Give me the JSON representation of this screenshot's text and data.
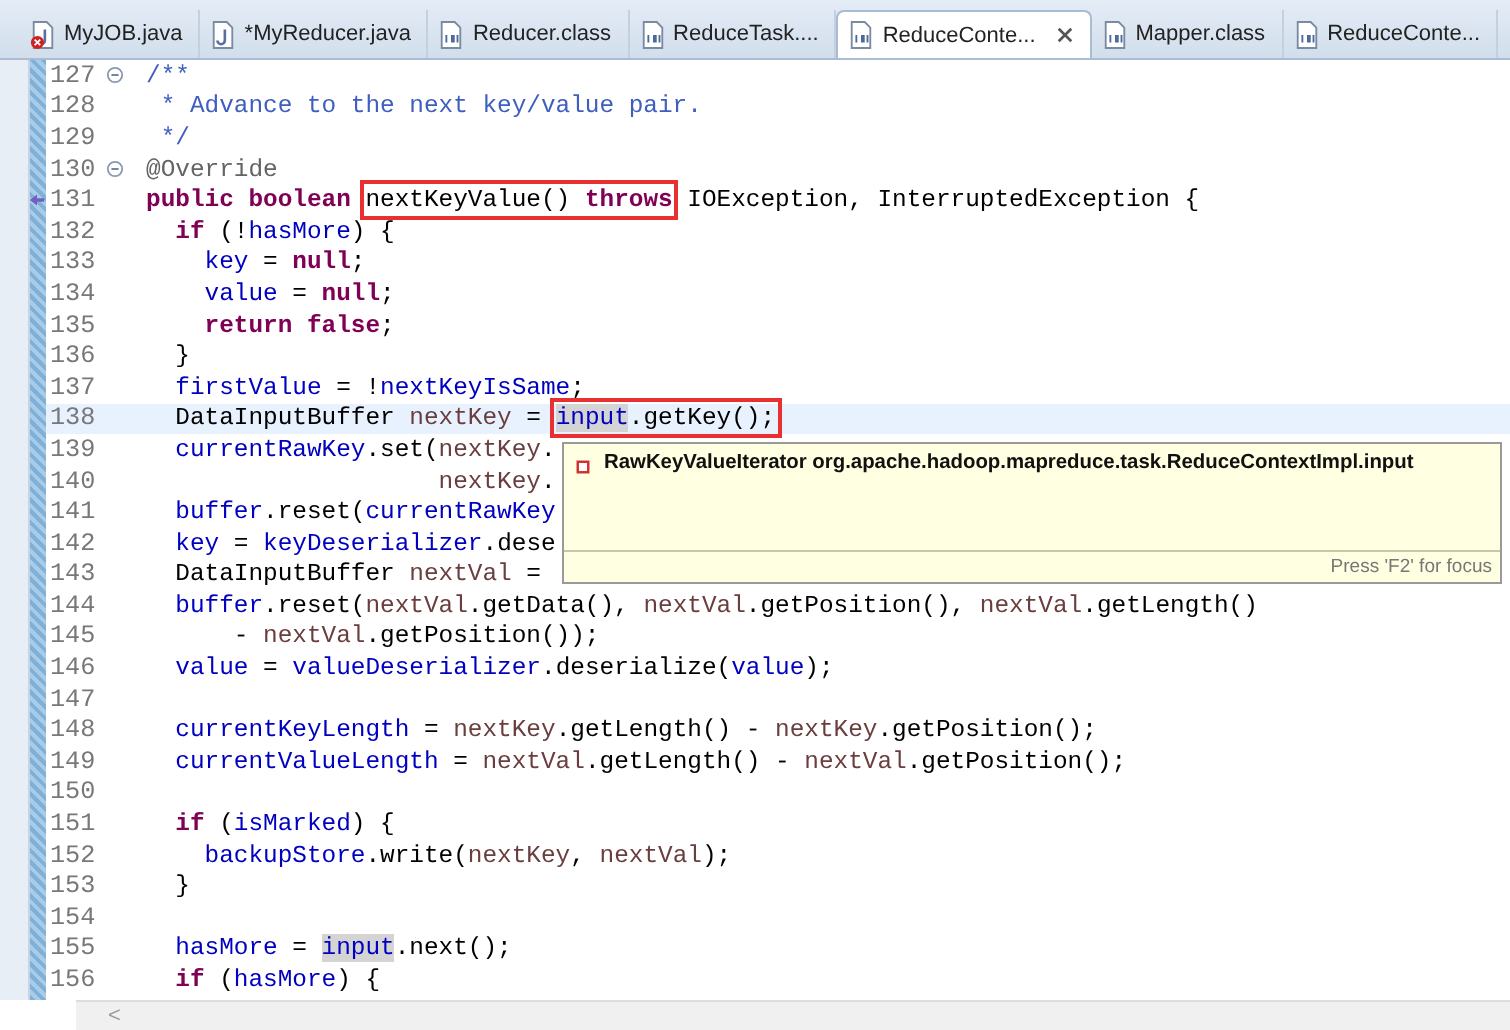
{
  "tabs": [
    {
      "label": "MyJOB.java",
      "kind": "java-error",
      "selected": false,
      "closable": false
    },
    {
      "label": "*MyReducer.java",
      "kind": "java",
      "selected": false,
      "closable": false
    },
    {
      "label": "Reducer.class",
      "kind": "class",
      "selected": false,
      "closable": false
    },
    {
      "label": "ReduceTask....",
      "kind": "class",
      "selected": false,
      "closable": false
    },
    {
      "label": "ReduceConte...",
      "kind": "class",
      "selected": true,
      "closable": true
    },
    {
      "label": "Mapper.class",
      "kind": "class",
      "selected": false,
      "closable": false
    },
    {
      "label": "ReduceConte...",
      "kind": "class",
      "selected": false,
      "closable": false
    }
  ],
  "lines": [
    {
      "number": "127",
      "fold": true,
      "current": false,
      "overrides": false,
      "tokens": [
        {
          "text": "/**",
          "kind": "doc"
        }
      ]
    },
    {
      "number": "128",
      "fold": false,
      "current": false,
      "overrides": false,
      "tokens": [
        {
          "text": " * Advance to the next key/value pair.",
          "kind": "doc"
        }
      ]
    },
    {
      "number": "129",
      "fold": false,
      "current": false,
      "overrides": false,
      "tokens": [
        {
          "text": " */",
          "kind": "doc"
        }
      ]
    },
    {
      "number": "130",
      "fold": true,
      "current": false,
      "overrides": false,
      "tokens": [
        {
          "text": "@Override",
          "kind": "annotation"
        }
      ]
    },
    {
      "number": "131",
      "fold": false,
      "current": false,
      "overrides": true,
      "tokens": [
        {
          "text": "public",
          "kind": "keyword"
        },
        {
          "text": " boolean ",
          "kind": "keyword"
        },
        {
          "kind": "boxed",
          "parts": [
            {
              "text": "nextKeyValue() ",
              "kind": "plain"
            },
            {
              "text": "throws",
              "kind": "keyword"
            }
          ]
        },
        {
          "text": " IOException, InterruptedException {",
          "kind": "plain"
        }
      ]
    },
    {
      "number": "132",
      "fold": false,
      "current": false,
      "overrides": false,
      "tokens": [
        {
          "text": "  if",
          "kind": "keyword"
        },
        {
          "text": " (!",
          "kind": "plain"
        },
        {
          "text": "hasMore",
          "kind": "field"
        },
        {
          "text": ") {",
          "kind": "plain"
        }
      ]
    },
    {
      "number": "133",
      "fold": false,
      "current": false,
      "overrides": false,
      "tokens": [
        {
          "text": "    key",
          "kind": "field"
        },
        {
          "text": " = ",
          "kind": "plain"
        },
        {
          "text": "null",
          "kind": "keyword"
        },
        {
          "text": ";",
          "kind": "plain"
        }
      ]
    },
    {
      "number": "134",
      "fold": false,
      "current": false,
      "overrides": false,
      "tokens": [
        {
          "text": "    value",
          "kind": "field"
        },
        {
          "text": " = ",
          "kind": "plain"
        },
        {
          "text": "null",
          "kind": "keyword"
        },
        {
          "text": ";",
          "kind": "plain"
        }
      ]
    },
    {
      "number": "135",
      "fold": false,
      "current": false,
      "overrides": false,
      "tokens": [
        {
          "text": "    return",
          "kind": "keyword"
        },
        {
          "text": " false",
          "kind": "keyword"
        },
        {
          "text": ";",
          "kind": "plain"
        }
      ]
    },
    {
      "number": "136",
      "fold": false,
      "current": false,
      "overrides": false,
      "tokens": [
        {
          "text": "  }",
          "kind": "plain"
        }
      ]
    },
    {
      "number": "137",
      "fold": false,
      "current": false,
      "overrides": false,
      "tokens": [
        {
          "text": "  firstValue",
          "kind": "field"
        },
        {
          "text": " = !",
          "kind": "plain"
        },
        {
          "text": "nextKeyIsSame",
          "kind": "field"
        },
        {
          "text": ";",
          "kind": "plain"
        }
      ]
    },
    {
      "number": "138",
      "fold": false,
      "current": true,
      "overrides": false,
      "tokens": [
        {
          "text": "  DataInputBuffer ",
          "kind": "plain"
        },
        {
          "text": "nextKey",
          "kind": "local"
        },
        {
          "text": " = ",
          "kind": "plain"
        },
        {
          "kind": "boxed",
          "parts": [
            {
              "text": "input",
              "kind": "field",
              "highlighted": true
            },
            {
              "text": ".getKey();",
              "kind": "plain"
            }
          ]
        }
      ]
    },
    {
      "number": "139",
      "fold": false,
      "current": false,
      "overrides": false,
      "tokens": [
        {
          "text": "  currentRawKey",
          "kind": "field"
        },
        {
          "text": ".set(",
          "kind": "plain"
        },
        {
          "text": "nextKey",
          "kind": "local"
        },
        {
          "text": ".",
          "kind": "plain"
        }
      ]
    },
    {
      "number": "140",
      "fold": false,
      "current": false,
      "overrides": false,
      "tokens": [
        {
          "text": "                    nextKey",
          "kind": "local"
        },
        {
          "text": ".",
          "kind": "plain"
        }
      ]
    },
    {
      "number": "141",
      "fold": false,
      "current": false,
      "overrides": false,
      "tokens": [
        {
          "text": "  buffer",
          "kind": "field"
        },
        {
          "text": ".reset(",
          "kind": "plain"
        },
        {
          "text": "currentRawKey",
          "kind": "field"
        }
      ]
    },
    {
      "number": "142",
      "fold": false,
      "current": false,
      "overrides": false,
      "tokens": [
        {
          "text": "  key",
          "kind": "field"
        },
        {
          "text": " = ",
          "kind": "plain"
        },
        {
          "text": "keyDeserializer",
          "kind": "field"
        },
        {
          "text": ".dese",
          "kind": "plain"
        }
      ]
    },
    {
      "number": "143",
      "fold": false,
      "current": false,
      "overrides": false,
      "tokens": [
        {
          "text": "  DataInputBuffer ",
          "kind": "plain"
        },
        {
          "text": "nextVal",
          "kind": "local"
        },
        {
          "text": " =",
          "kind": "plain"
        }
      ]
    },
    {
      "number": "144",
      "fold": false,
      "current": false,
      "overrides": false,
      "tokens": [
        {
          "text": "  buffer",
          "kind": "field"
        },
        {
          "text": ".reset(",
          "kind": "plain"
        },
        {
          "text": "nextVal",
          "kind": "local"
        },
        {
          "text": ".getData(), ",
          "kind": "plain"
        },
        {
          "text": "nextVal",
          "kind": "local"
        },
        {
          "text": ".getPosition(), ",
          "kind": "plain"
        },
        {
          "text": "nextVal",
          "kind": "local"
        },
        {
          "text": ".getLength()",
          "kind": "plain"
        }
      ]
    },
    {
      "number": "145",
      "fold": false,
      "current": false,
      "overrides": false,
      "tokens": [
        {
          "text": "      - ",
          "kind": "plain"
        },
        {
          "text": "nextVal",
          "kind": "local"
        },
        {
          "text": ".getPosition());",
          "kind": "plain"
        }
      ]
    },
    {
      "number": "146",
      "fold": false,
      "current": false,
      "overrides": false,
      "tokens": [
        {
          "text": "  value",
          "kind": "field"
        },
        {
          "text": " = ",
          "kind": "plain"
        },
        {
          "text": "valueDeserializer",
          "kind": "field"
        },
        {
          "text": ".deserialize(",
          "kind": "plain"
        },
        {
          "text": "value",
          "kind": "field"
        },
        {
          "text": ");",
          "kind": "plain"
        }
      ]
    },
    {
      "number": "147",
      "fold": false,
      "current": false,
      "overrides": false
    },
    {
      "number": "148",
      "fold": false,
      "current": false,
      "overrides": false,
      "tokens": [
        {
          "text": "  currentKeyLength",
          "kind": "field"
        },
        {
          "text": " = ",
          "kind": "plain"
        },
        {
          "text": "nextKey",
          "kind": "local"
        },
        {
          "text": ".getLength() - ",
          "kind": "plain"
        },
        {
          "text": "nextKey",
          "kind": "local"
        },
        {
          "text": ".getPosition();",
          "kind": "plain"
        }
      ]
    },
    {
      "number": "149",
      "fold": false,
      "current": false,
      "overrides": false,
      "tokens": [
        {
          "text": "  currentValueLength",
          "kind": "field"
        },
        {
          "text": " = ",
          "kind": "plain"
        },
        {
          "text": "nextVal",
          "kind": "local"
        },
        {
          "text": ".getLength() - ",
          "kind": "plain"
        },
        {
          "text": "nextVal",
          "kind": "local"
        },
        {
          "text": ".getPosition();",
          "kind": "plain"
        }
      ]
    },
    {
      "number": "150",
      "fold": false,
      "current": false,
      "overrides": false
    },
    {
      "number": "151",
      "fold": false,
      "current": false,
      "overrides": false,
      "tokens": [
        {
          "text": "  if",
          "kind": "keyword"
        },
        {
          "text": " (",
          "kind": "plain"
        },
        {
          "text": "isMarked",
          "kind": "field"
        },
        {
          "text": ") {",
          "kind": "plain"
        }
      ]
    },
    {
      "number": "152",
      "fold": false,
      "current": false,
      "overrides": false,
      "tokens": [
        {
          "text": "    backupStore",
          "kind": "field"
        },
        {
          "text": ".write(",
          "kind": "plain"
        },
        {
          "text": "nextKey",
          "kind": "local"
        },
        {
          "text": ", ",
          "kind": "plain"
        },
        {
          "text": "nextVal",
          "kind": "local"
        },
        {
          "text": ");",
          "kind": "plain"
        }
      ]
    },
    {
      "number": "153",
      "fold": false,
      "current": false,
      "overrides": false,
      "tokens": [
        {
          "text": "  }",
          "kind": "plain"
        }
      ]
    },
    {
      "number": "154",
      "fold": false,
      "current": false,
      "overrides": false
    },
    {
      "number": "155",
      "fold": false,
      "current": false,
      "overrides": false,
      "tokens": [
        {
          "text": "  hasMore",
          "kind": "field"
        },
        {
          "text": " = ",
          "kind": "plain"
        },
        {
          "text": "input",
          "kind": "field",
          "highlighted": true
        },
        {
          "text": ".next();",
          "kind": "plain"
        }
      ]
    },
    {
      "number": "156",
      "fold": false,
      "current": false,
      "overrides": false,
      "tokens": [
        {
          "text": "  if",
          "kind": "keyword"
        },
        {
          "text": " (",
          "kind": "plain"
        },
        {
          "text": "hasMore",
          "kind": "field"
        },
        {
          "text": ") {",
          "kind": "plain"
        }
      ]
    }
  ],
  "hover": {
    "item": "RawKeyValueIterator org.apache.hadoop.mapreduce.task.ReduceContextImpl.input",
    "hint": "Press 'F2' for focus"
  },
  "scrollbar": {
    "arrow": "<"
  }
}
